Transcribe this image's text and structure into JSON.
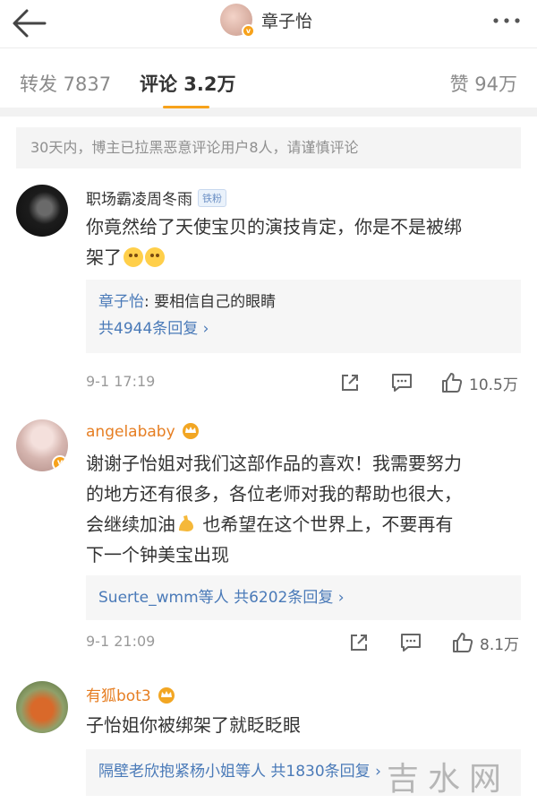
{
  "header": {
    "title": "章子怡",
    "badge": "v"
  },
  "tabs": [
    {
      "label": "转发 7837"
    },
    {
      "label": "评论 3.2万"
    },
    {
      "label": "赞 94万"
    }
  ],
  "notice": "30天内，博主已拉黑恶意评论用户8人，请谨慎评论",
  "comments": [
    {
      "username": "职场霸凌周冬雨",
      "badge": "铁粉",
      "text_line1": "你竟然给了天使宝贝的演技肯定，你是不是被绑",
      "text_line2": "架了",
      "reply_author": "章子怡",
      "reply_text": ": 要相信自己的眼睛",
      "reply_more": "共4944条回复 ›",
      "time": "9-1 17:19",
      "likes": "10.5万"
    },
    {
      "username": "angelababy",
      "text_line1": "谢谢子怡姐对我们这部作品的喜欢！我需要努力",
      "text_line2": "的地方还有很多，各位老师对我的帮助也很大，",
      "text_line3a": "会继续加油",
      "text_line3b": " 也希望在这个世界上，不要再有",
      "text_line4": "下一个钟美宝出现",
      "reply_more": "Suerte_wmm等人  共6202条回复 ›",
      "time": "9-1 21:09",
      "likes": "8.1万"
    },
    {
      "username": "有狐bot3",
      "text_line1": "子怡姐你被绑架了就眨眨眼",
      "reply_more": "隔壁老欣抱紧杨小姐等人  共1830条回复 ›"
    }
  ],
  "watermark": "吉水网",
  "colors": {
    "accent": "#f7a21b",
    "link": "#4a7ab8",
    "vip_name": "#e67e22"
  }
}
